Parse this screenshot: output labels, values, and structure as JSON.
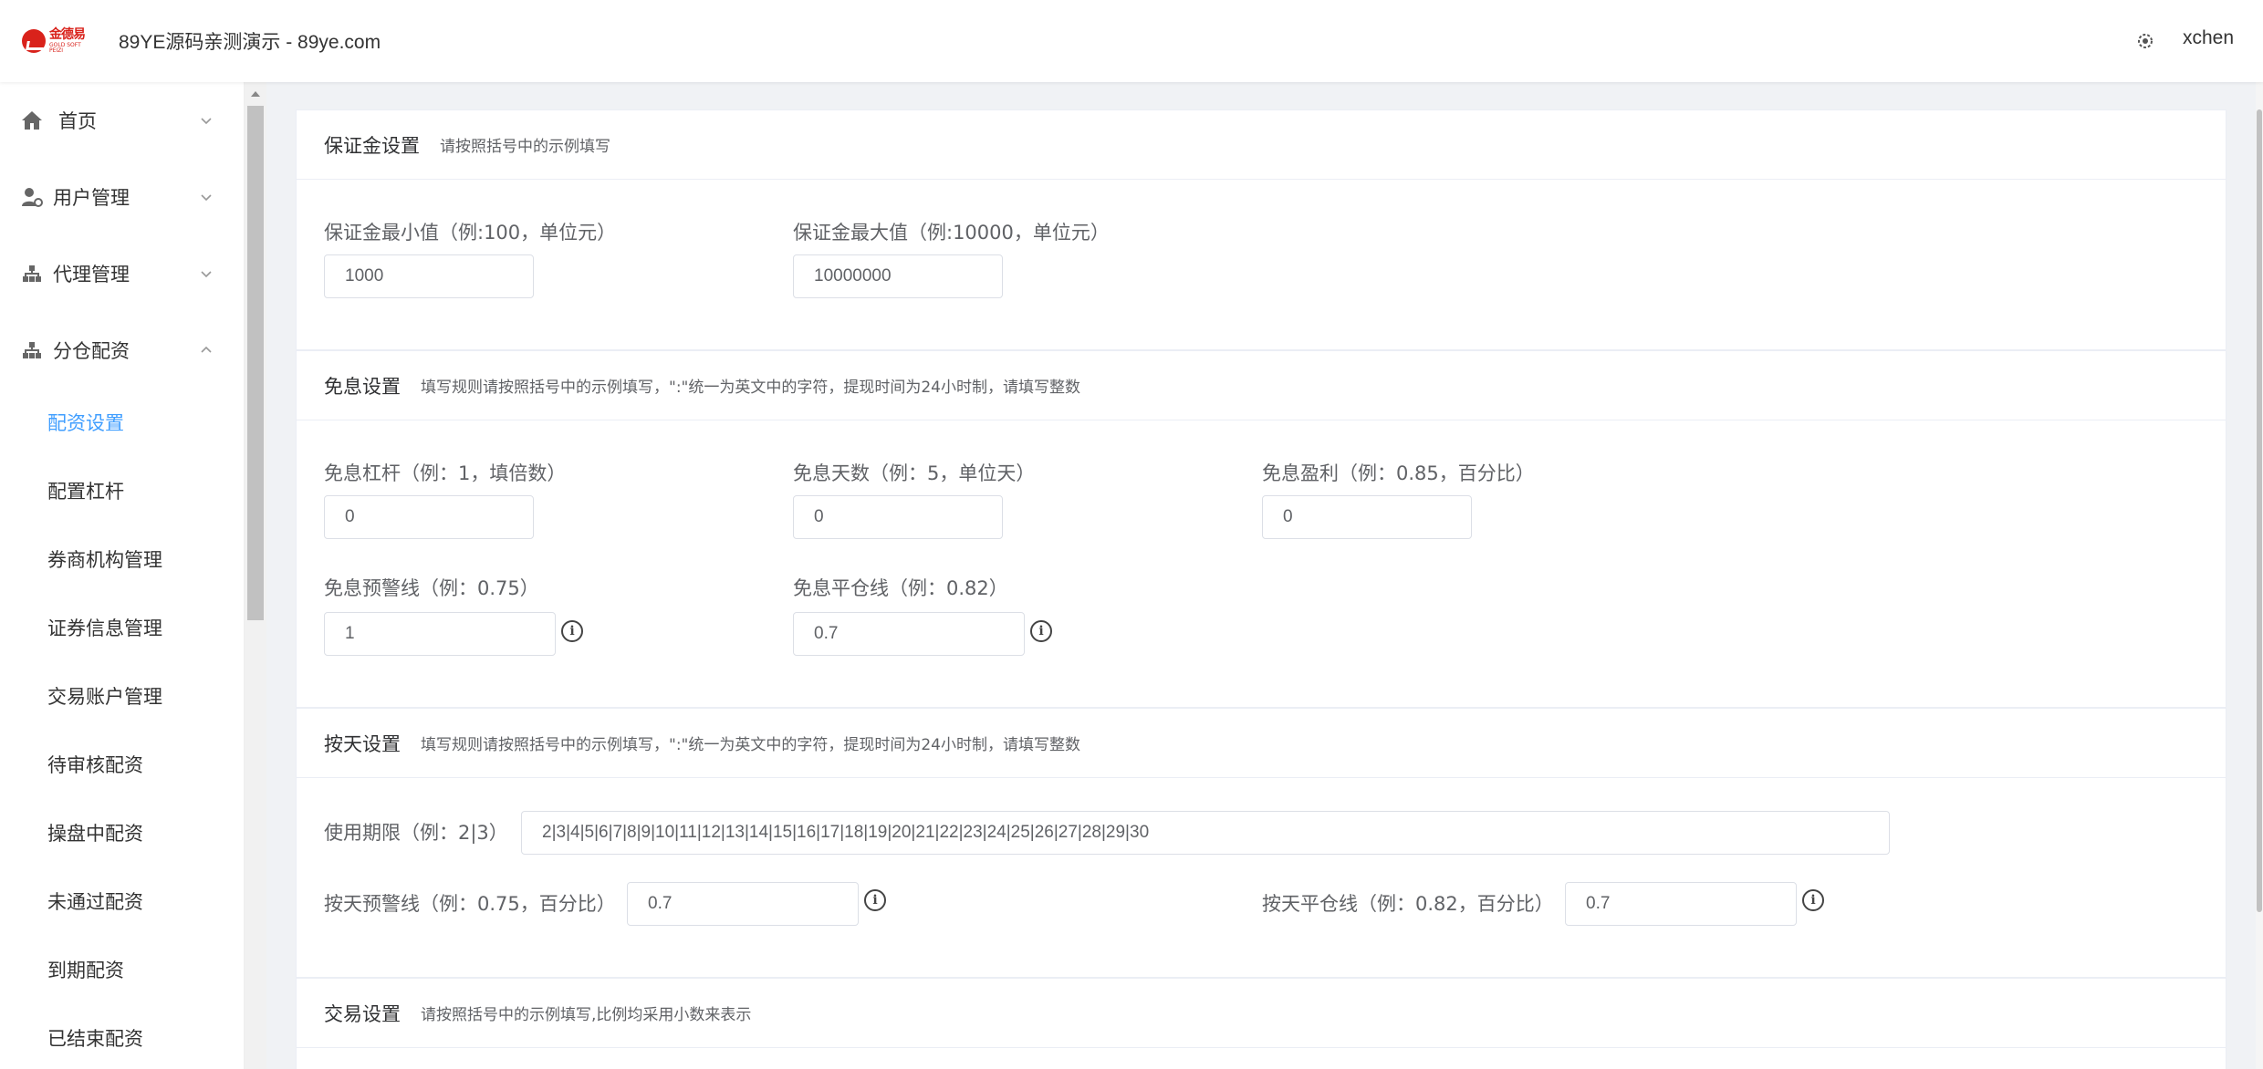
{
  "header": {
    "logo_cn": "金德易",
    "logo_en": "GOLD SOFT PEIZI",
    "site_title": "89YE源码亲测演示 - 89ye.com",
    "user_name": "xchen"
  },
  "sidebar": {
    "groups": [
      {
        "label": "首页",
        "icon": "home-icon",
        "expanded": false
      },
      {
        "label": "用户管理",
        "icon": "user-icon",
        "expanded": false
      },
      {
        "label": "代理管理",
        "icon": "org-chart-icon",
        "expanded": false
      },
      {
        "label": "分仓配资",
        "icon": "org-chart-icon",
        "expanded": true
      }
    ],
    "sub_items": [
      {
        "label": "配资设置",
        "active": true
      },
      {
        "label": "配置杠杆",
        "active": false
      },
      {
        "label": "券商机构管理",
        "active": false
      },
      {
        "label": "证券信息管理",
        "active": false
      },
      {
        "label": "交易账户管理",
        "active": false
      },
      {
        "label": "待审核配资",
        "active": false
      },
      {
        "label": "操盘中配资",
        "active": false
      },
      {
        "label": "未通过配资",
        "active": false
      },
      {
        "label": "到期配资",
        "active": false
      },
      {
        "label": "已结束配资",
        "active": false
      }
    ]
  },
  "cards": {
    "deposit": {
      "title": "保证金设置",
      "hint": "请按照括号中的示例填写",
      "min_label": "保证金最小值（例:100，单位元）",
      "min_value": "1000",
      "max_label": "保证金最大值（例:10000，单位元）",
      "max_value": "10000000"
    },
    "free_interest": {
      "title": "免息设置",
      "hint": "填写规则请按照括号中的示例填写，\":\"统一为英文中的字符，提现时间为24小时制，请填写整数",
      "leverage_label": "免息杠杆（例：1，填倍数）",
      "leverage_value": "0",
      "days_label": "免息天数（例：5，单位天）",
      "days_value": "0",
      "profit_label": "免息盈利（例：0.85，百分比）",
      "profit_value": "0",
      "warning_label": "免息预警线（例：0.75）",
      "warning_value": "1",
      "close_label": "免息平仓线（例：0.82）",
      "close_value": "0.7"
    },
    "daily": {
      "title": "按天设置",
      "hint": "填写规则请按照括号中的示例填写，\":\"统一为英文中的字符，提现时间为24小时制，请填写整数",
      "period_label": "使用期限（例：2|3）",
      "period_value": "2|3|4|5|6|7|8|9|10|11|12|13|14|15|16|17|18|19|20|21|22|23|24|25|26|27|28|29|30",
      "warning_label": "按天预警线（例：0.75，百分比）",
      "warning_value": "0.7",
      "close_label": "按天平仓线（例：0.82，百分比）",
      "close_value": "0.7"
    },
    "trade": {
      "title": "交易设置",
      "hint": "请按照括号中的示例填写,比例均采用小数来表示"
    }
  },
  "info_glyph": "i"
}
